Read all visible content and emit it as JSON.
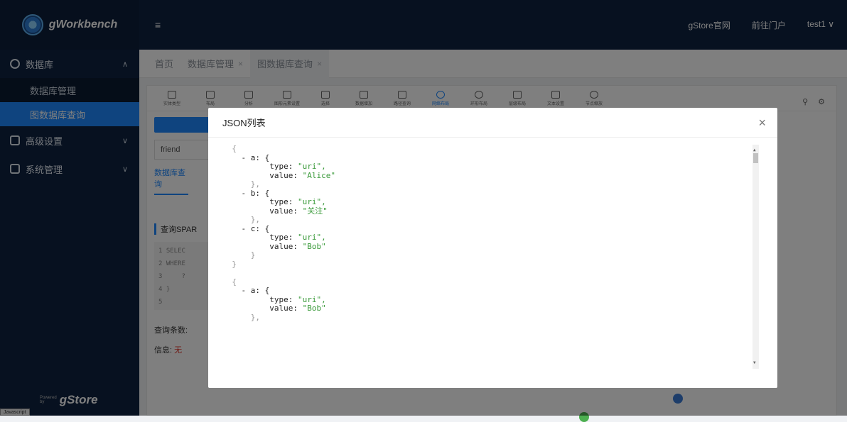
{
  "brand": {
    "name": "gWorkbench",
    "powered_small": "Powered\nby",
    "powered_name": "gStore"
  },
  "js_badge": "Javascript",
  "sidebar": {
    "items": [
      {
        "label": "数据库",
        "expanded": true,
        "children": [
          {
            "label": "数据库管理"
          },
          {
            "label": "图数据库查询",
            "active": true
          }
        ]
      },
      {
        "label": "高级设置"
      },
      {
        "label": "系统管理"
      }
    ]
  },
  "topbar": {
    "menu_icon": "≡",
    "links": [
      "gStore官网",
      "前往门户",
      "test1 ∨"
    ]
  },
  "tabs": [
    {
      "label": "首页"
    },
    {
      "label": "数据库管理",
      "close": "×"
    },
    {
      "label": "图数据库查询",
      "close": "×",
      "active": true
    }
  ],
  "toolbar": {
    "tools": [
      "实体类型",
      "布局",
      "分析",
      "图形元素设置",
      "选择",
      "数据增加",
      "路径查询",
      "网络布局",
      "环形布局",
      "层级布局",
      "文本设置",
      "节点缩放"
    ]
  },
  "background_panel": {
    "db_value": "friend",
    "link": "数据库查询",
    "sparql_title": "查询SPAR",
    "code_lines": [
      "1 SELEC",
      "2 WHERE",
      "3     ?",
      "4 }",
      "5"
    ],
    "count_label": "查询条数:",
    "info_label": "信息: ",
    "info_value": "无"
  },
  "modal": {
    "title": "JSON列表",
    "close": "×",
    "lines": [
      {
        "t": "  {",
        "c": "br"
      },
      {
        "t": "    - a: {",
        "c": "k"
      },
      {
        "t": "          type: ",
        "c": "k",
        "s": "\"uri\","
      },
      {
        "t": "          value: ",
        "c": "k",
        "s": "\"Alice\""
      },
      {
        "t": "      },",
        "c": "br"
      },
      {
        "t": "    - b: {",
        "c": "k"
      },
      {
        "t": "          type: ",
        "c": "k",
        "s": "\"uri\","
      },
      {
        "t": "          value: ",
        "c": "k",
        "s": "\"关注\""
      },
      {
        "t": "      },",
        "c": "br"
      },
      {
        "t": "    - c: {",
        "c": "k"
      },
      {
        "t": "          type: ",
        "c": "k",
        "s": "\"uri\","
      },
      {
        "t": "          value: ",
        "c": "k",
        "s": "\"Bob\""
      },
      {
        "t": "      }",
        "c": "br"
      },
      {
        "t": "  }",
        "c": "br"
      },
      {
        "t": "",
        "c": "br"
      },
      {
        "t": "  {",
        "c": "br"
      },
      {
        "t": "    - a: {",
        "c": "k"
      },
      {
        "t": "          type: ",
        "c": "k",
        "s": "\"uri\","
      },
      {
        "t": "          value: ",
        "c": "k",
        "s": "\"Bob\""
      },
      {
        "t": "      },",
        "c": "br"
      }
    ]
  }
}
